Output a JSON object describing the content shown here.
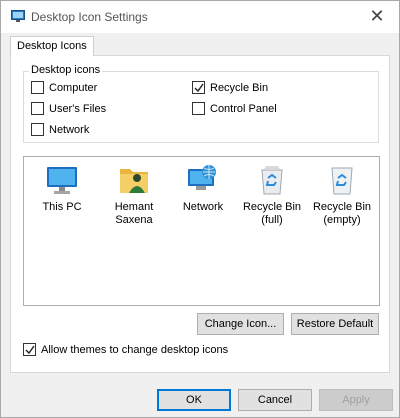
{
  "window": {
    "title": "Desktop Icon Settings",
    "close_glyph": "✕"
  },
  "tabs": [
    {
      "label": "Desktop Icons"
    }
  ],
  "group": {
    "legend": "Desktop icons",
    "checkboxes": [
      {
        "label": "Computer",
        "checked": false
      },
      {
        "label": "Recycle Bin",
        "checked": true
      },
      {
        "label": "User's Files",
        "checked": false
      },
      {
        "label": "Control Panel",
        "checked": false
      },
      {
        "label": "Network",
        "checked": false
      }
    ]
  },
  "icons": [
    {
      "label": "This PC",
      "icon": "monitor-icon"
    },
    {
      "label": "Hemant Saxena",
      "icon": "user-folder-icon"
    },
    {
      "label": "Network",
      "icon": "network-globe-icon"
    },
    {
      "label": "Recycle Bin (full)",
      "icon": "recycle-bin-full-icon"
    },
    {
      "label": "Recycle Bin (empty)",
      "icon": "recycle-bin-empty-icon"
    }
  ],
  "buttons": {
    "change_icon": "Change Icon...",
    "restore_default": "Restore Default",
    "ok": "OK",
    "cancel": "Cancel",
    "apply": "Apply"
  },
  "themes_checkbox": {
    "label": "Allow themes to change desktop icons",
    "checked": true
  },
  "colors": {
    "accent": "#0078d7",
    "folder": "#e8b63c",
    "recycle": "#2e8ad8"
  }
}
